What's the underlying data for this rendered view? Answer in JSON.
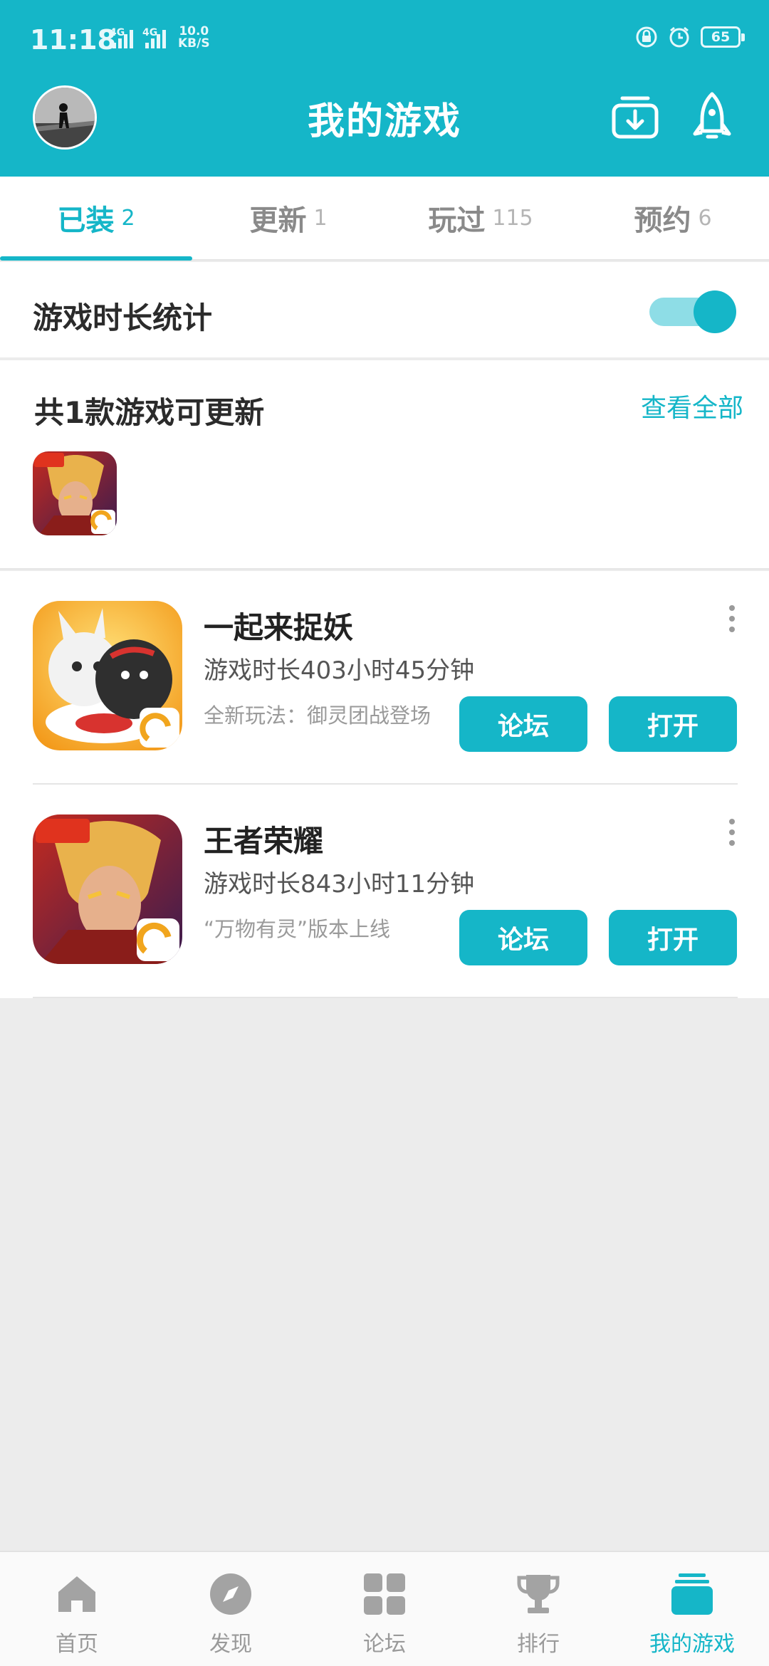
{
  "status_bar": {
    "time": "11:18",
    "net1": "4G",
    "net2": "4G",
    "speed_value": "10.0",
    "speed_unit": "KB/S",
    "battery": "65"
  },
  "header": {
    "title": "我的游戏",
    "download_icon": "download-box-icon",
    "rocket_icon": "rocket-icon"
  },
  "tabs": [
    {
      "label": "已装",
      "count": "2",
      "active": true
    },
    {
      "label": "更新",
      "count": "1",
      "active": false
    },
    {
      "label": "玩过",
      "count": "115",
      "active": false
    },
    {
      "label": "预约",
      "count": "6",
      "active": false
    }
  ],
  "stats_toggle": {
    "label": "游戏时长统计",
    "enabled": true
  },
  "updates": {
    "title": "共1款游戏可更新",
    "view_all": "查看全部"
  },
  "games": [
    {
      "name": "一起来捉妖",
      "duration": "游戏时长403小时45分钟",
      "desc": "全新玩法：御灵团战登场",
      "forum": "论坛",
      "open": "打开"
    },
    {
      "name": "王者荣耀",
      "duration": "游戏时长843小时11分钟",
      "desc": "“万物有灵”版本上线",
      "forum": "论坛",
      "open": "打开"
    }
  ],
  "bottom_nav": [
    {
      "label": "首页",
      "icon": "home-icon",
      "active": false
    },
    {
      "label": "发现",
      "icon": "compass-icon",
      "active": false
    },
    {
      "label": "论坛",
      "icon": "grid-icon",
      "active": false
    },
    {
      "label": "排行",
      "icon": "trophy-icon",
      "active": false
    },
    {
      "label": "我的游戏",
      "icon": "stack-icon",
      "active": true
    }
  ],
  "colors": {
    "accent": "#15b6c8",
    "toggle_track": "#8edde6",
    "background": "#ececec"
  }
}
